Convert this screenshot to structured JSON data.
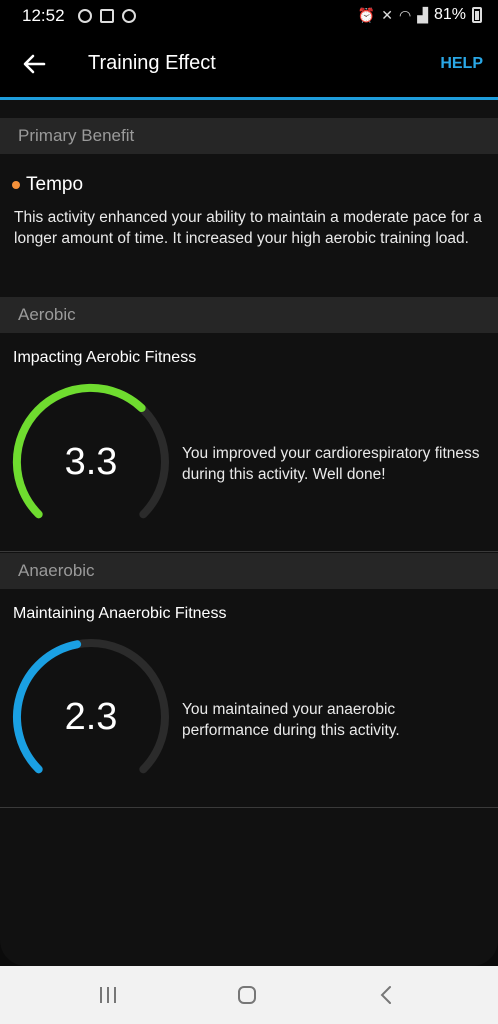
{
  "status_bar": {
    "time": "12:52",
    "battery": "81%"
  },
  "app_bar": {
    "title": "Training Effect",
    "help": "HELP"
  },
  "primary": {
    "header": "Primary Benefit",
    "label": "Tempo",
    "dot_color": "#f5913a",
    "description": "This activity enhanced your ability to maintain a moderate pace for a longer amount of time. It increased your high aerobic training load."
  },
  "aerobic": {
    "header": "Aerobic",
    "title": "Impacting Aerobic Fitness",
    "value": "3.3",
    "level": 3.3,
    "max": 5,
    "color": "#6fdc2f",
    "description": "You improved your cardiorespiratory fitness during this activity. Well done!"
  },
  "anaerobic": {
    "header": "Anaerobic",
    "title": "Maintaining Anaerobic Fitness",
    "value": "2.3",
    "level": 2.3,
    "max": 5,
    "color": "#1aa0e3",
    "description": "You maintained your anaerobic performance during this activity."
  },
  "nav": {
    "icons": [
      "recent-apps-icon",
      "home-icon",
      "back-icon"
    ]
  }
}
